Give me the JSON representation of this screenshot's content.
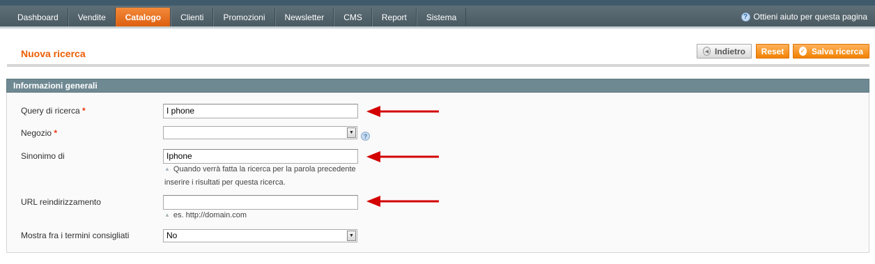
{
  "nav": {
    "items": [
      {
        "label": "Dashboard"
      },
      {
        "label": "Vendite"
      },
      {
        "label": "Catalogo",
        "active": true
      },
      {
        "label": "Clienti"
      },
      {
        "label": "Promozioni"
      },
      {
        "label": "Newsletter"
      },
      {
        "label": "CMS"
      },
      {
        "label": "Report"
      },
      {
        "label": "Sistema"
      }
    ],
    "help_label": "Ottieni aiuto per questa pagina"
  },
  "page": {
    "title": "Nuova ricerca",
    "buttons": {
      "back": "Indietro",
      "reset": "Reset",
      "save": "Salva ricerca"
    }
  },
  "section": {
    "title": "Informazioni generali"
  },
  "form": {
    "query": {
      "label": "Query di ricerca",
      "required": "*",
      "value": "I phone"
    },
    "store": {
      "label": "Negozio",
      "required": "*",
      "value": ""
    },
    "synonym": {
      "label": "Sinonimo di",
      "value": "Iphone",
      "note_line1": "Quando verrà fatta la ricerca per la parola precedente",
      "note_line2": "inserire i risultati per questa ricerca."
    },
    "redirect": {
      "label": "URL reindirizzamento",
      "value": "",
      "note": "es. http://domain.com"
    },
    "suggested": {
      "label": "Mostra fra i termini consigliati",
      "value": "No"
    }
  },
  "colors": {
    "accent": "#eb5e00",
    "nav_active": "#f18200",
    "annotation_arrow": "#d40000"
  }
}
